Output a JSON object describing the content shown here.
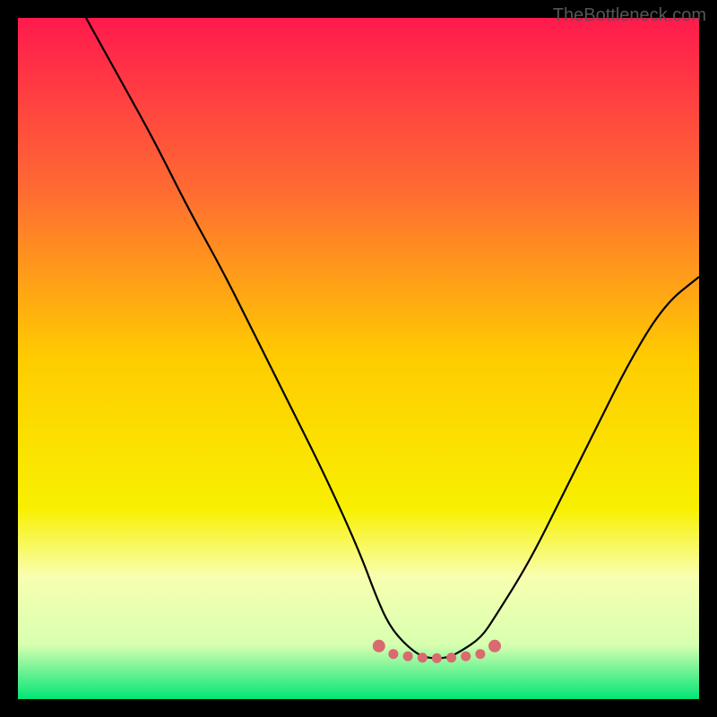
{
  "watermark": "TheBottleneck.com",
  "chart_data": {
    "type": "line",
    "title": "",
    "xlabel": "",
    "ylabel": "",
    "xlim": [
      0,
      100
    ],
    "ylim": [
      0,
      100
    ],
    "grid": false,
    "legend": false,
    "series": [
      {
        "name": "curve",
        "x": [
          10,
          15,
          20,
          25,
          30,
          35,
          40,
          45,
          50,
          53,
          55,
          58,
          60,
          63,
          65,
          68,
          70,
          75,
          80,
          85,
          90,
          95,
          100
        ],
        "y": [
          100,
          91,
          82,
          72,
          63,
          53,
          43,
          33,
          22,
          14,
          10,
          7,
          6,
          6,
          7,
          9,
          12,
          20,
          30,
          40,
          50,
          58,
          62
        ]
      }
    ],
    "marker_band": {
      "x_start": 53,
      "x_end": 70,
      "y": 7,
      "color": "#d96a6f"
    },
    "background_gradient": {
      "stops": [
        {
          "offset": 0.0,
          "color": "#ff1a4d"
        },
        {
          "offset": 0.25,
          "color": "#ff6a33"
        },
        {
          "offset": 0.5,
          "color": "#ffcc00"
        },
        {
          "offset": 0.72,
          "color": "#f8f000"
        },
        {
          "offset": 0.82,
          "color": "#f8ffb0"
        },
        {
          "offset": 0.92,
          "color": "#d8ffb0"
        },
        {
          "offset": 1.0,
          "color": "#00e676"
        }
      ]
    }
  }
}
